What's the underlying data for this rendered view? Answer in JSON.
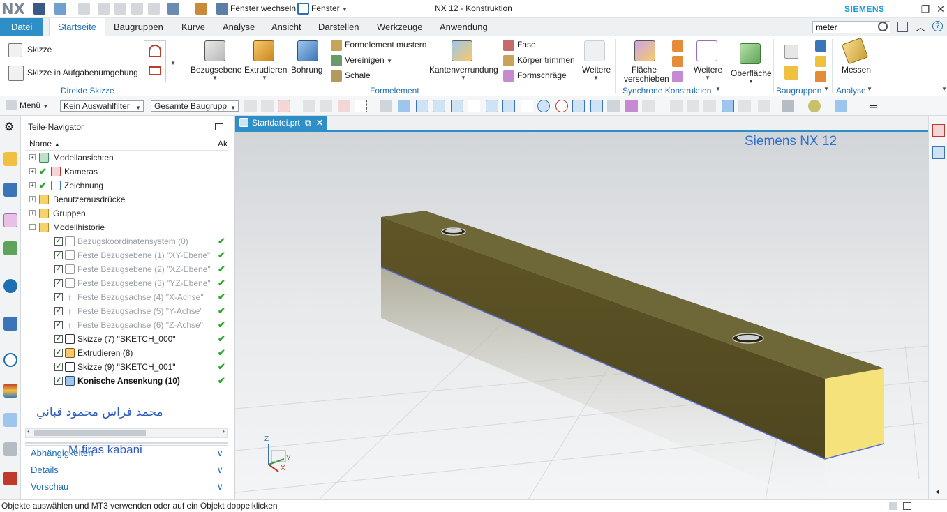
{
  "app": {
    "logo": "NX",
    "window_title": "NX 12 - Konstruktion",
    "brand": "SIEMENS",
    "quick_access": {
      "switch_window": "Fenster wechseln",
      "window_menu": "Fenster"
    }
  },
  "ribbon_tabs": [
    "Datei",
    "Startseite",
    "Baugruppen",
    "Kurve",
    "Analyse",
    "Ansicht",
    "Darstellen",
    "Werkzeuge",
    "Anwendung"
  ],
  "search": {
    "value": "meter"
  },
  "ribbon": {
    "direct_sketch": {
      "title": "Direkte Skizze",
      "sketch": "Skizze",
      "sketch_in_task": "Skizze in Aufgabenumgebung"
    },
    "feature": {
      "title": "Formelement",
      "datum_plane": "Bezugsebene",
      "extrude": "Extrudieren",
      "hole": "Bohrung",
      "pattern_feature": "Formelement mustern",
      "unite": "Vereinigen",
      "shell": "Schale",
      "edge_blend": "Kantenverrundung",
      "chamfer": "Fase",
      "trim_body": "Körper trimmen",
      "draft": "Formschräge",
      "more": "Weitere"
    },
    "sync": {
      "title": "Synchrone Konstruktion",
      "move_face_line1": "Fläche",
      "move_face_line2": "verschieben",
      "more": "Weitere"
    },
    "surface": {
      "label": "Oberfläche"
    },
    "assemblies": {
      "title": "Baugruppen"
    },
    "analysis": {
      "title": "Analyse",
      "measure": "Messen"
    }
  },
  "toolbar": {
    "menu": "Menü",
    "selection_filter": "Kein Auswahlfilter",
    "scope": "Gesamte Baugrupp"
  },
  "navigator": {
    "title": "Teile-Navigator",
    "col_name": "Name",
    "col_status": "Ak",
    "items": [
      {
        "label": "Modellansichten"
      },
      {
        "label": "Kameras"
      },
      {
        "label": "Zeichnung"
      },
      {
        "label": "Benutzerausdrücke"
      },
      {
        "label": "Gruppen"
      },
      {
        "label": "Modellhistorie"
      },
      {
        "label": "Bezugskoordinatensystem (0)"
      },
      {
        "label": "Feste Bezugsebene (1) \"XY-Ebene\""
      },
      {
        "label": "Feste Bezugsebene (2) \"XZ-Ebene\""
      },
      {
        "label": "Feste Bezugsebene (3) \"YZ-Ebene\""
      },
      {
        "label": "Feste Bezugsachse (4) \"X-Achse\""
      },
      {
        "label": "Feste Bezugsachse (5) \"Y-Achse\""
      },
      {
        "label": "Feste Bezugsachse (6) \"Z-Achse\""
      },
      {
        "label": "Skizze (7) \"SKETCH_000\""
      },
      {
        "label": "Extrudieren (8)"
      },
      {
        "label": "Skizze (9) \"SKETCH_001\""
      },
      {
        "label": "Konische Ansenkung (10)"
      }
    ],
    "panels": [
      "Abhängigkeiten",
      "Details",
      "Vorschau"
    ],
    "watermark_arabic": "محمد فراس محمود قباني",
    "watermark_latin": "M.firas kabani"
  },
  "viewport": {
    "doc_tab": "Startdatei.prt",
    "overlay_text": "Siemens NX 12",
    "axes": {
      "x": "X",
      "y": "Y",
      "z": "Z"
    }
  },
  "statusbar": {
    "message": "Objekte auswählen und MT3 verwenden oder auf ein Objekt doppelklicken"
  },
  "colors": {
    "accent": "#2e8fc8",
    "body_top": "#6e6838",
    "body_front": "#5c5326",
    "body_end": "#f5e27a",
    "check_green": "#2aa52a"
  }
}
